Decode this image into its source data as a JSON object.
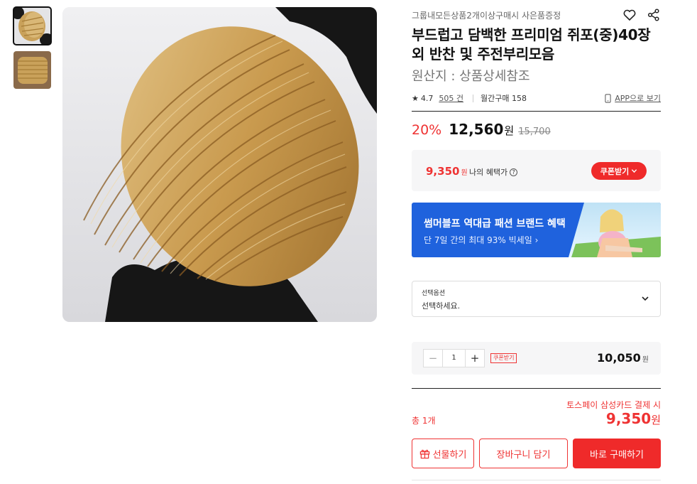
{
  "gallery": {
    "thumbnails": [
      "thumb-dried-fish-held",
      "thumb-dried-fish-stack"
    ],
    "active_index": 0,
    "main_image": "dried-filefish-stack-held-in-black-gloves"
  },
  "product": {
    "event_text": "그룹내모든상품2개이상구매시 사은품증정",
    "title": "부드럽고 담백한 프리미엄 쥐포(중)40장 외 반찬 및 주전부리모음",
    "origin": "원산지 : 상품상세참조",
    "rating": "4.7",
    "reviews": "505 건",
    "monthly_sales": "월간구매 158",
    "app_link": "APP으로 보기"
  },
  "price": {
    "discount": "20%",
    "sale_price": "12,560",
    "won": "원",
    "original_price": "15,700"
  },
  "benefit": {
    "price": "9,350",
    "won": "원",
    "label": "나의 혜택가",
    "coupon_button": "쿠폰받기"
  },
  "banner": {
    "title": "썸머블프 역대급 패션 브랜드 혜택",
    "subtitle": "단 7일 간의 최대 93% 빅세일"
  },
  "option": {
    "label": "선택옵션",
    "value": "선택하세요."
  },
  "quantity": {
    "value": "1",
    "minus": "−",
    "plus": "+",
    "coupon_tag": "쿠폰받기",
    "line_price": "10,050",
    "won": "원"
  },
  "total": {
    "pay_note": "토스페이 삼성카드 결제 시",
    "count_label": "총 1개",
    "price": "9,350",
    "won": "원"
  },
  "buttons": {
    "gift": "선물하기",
    "cart": "장바구니 담기",
    "buy": "바로 구매하기"
  },
  "colors": {
    "accent_red": "#ef2a2a",
    "banner_blue": "#1f62dd"
  }
}
